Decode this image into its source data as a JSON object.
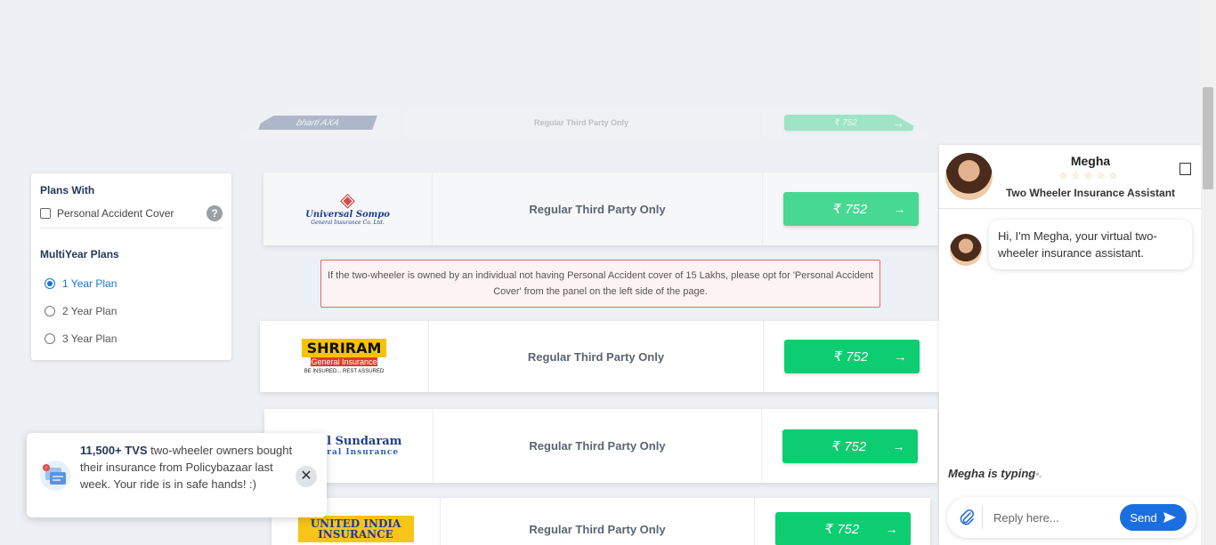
{
  "filters": {
    "plans_with_title": "Plans With",
    "personal_accident_label": "Personal Accident Cover",
    "help_icon": "?",
    "multiyear_title": "MultiYear Plans",
    "options": [
      {
        "label": "1 Year Plan",
        "selected": true
      },
      {
        "label": "2 Year Plan",
        "selected": false
      },
      {
        "label": "3 Year Plan",
        "selected": false
      }
    ]
  },
  "plans": [
    {
      "insurer_logo_text": "bharti AXA",
      "description": "Regular Third Party Only",
      "price": "₹ 752",
      "arrow": "→"
    },
    {
      "insurer_logo_text": "Universal Sompo",
      "insurer_logo_sub": "General Insurance Co. Ltd.",
      "description": "Regular Third Party Only",
      "price": "₹ 752",
      "arrow": "→"
    },
    {
      "insurer_logo_text": "SHRIRAM",
      "insurer_logo_sub": "General Insurance",
      "insurer_logo_tag": "BE INSURED... REST ASSURED",
      "description": "Regular Third Party Only",
      "price": "₹ 752",
      "arrow": "→"
    },
    {
      "insurer_logo_text": "Royal Sundaram",
      "insurer_logo_sub": "General Insurance",
      "description": "Regular Third Party Only",
      "price": "₹ 752",
      "arrow": "→"
    },
    {
      "insurer_logo_text": "UNITED INDIA INSURANCE",
      "description": "Regular Third Party Only",
      "price": "₹ 752",
      "arrow": "→"
    }
  ],
  "notice": {
    "text": "If the two-wheeler is owned by an individual not having Personal Accident cover of 15 Lakhs, please opt for 'Personal Accident Cover' from the panel on the left side of the page."
  },
  "toast": {
    "highlight": "11,500+ TVS",
    "text": " two-wheeler owners bought their insurance from Policybazaar last week. Your ride is in safe hands! :)",
    "close_icon": "✕"
  },
  "chat": {
    "agent_name": "Megha",
    "stars": "☆☆☆☆☆",
    "role": "Two Wheeler Insurance Assistant",
    "message": "Hi, I'm Megha, your virtual two-wheeler insurance assistant.",
    "typing": "Megha is typing",
    "typing_dots": "•.",
    "input_placeholder": "Reply here...",
    "send_label": "Send"
  },
  "colors": {
    "price_green": "#0ccd70",
    "notice_border": "#e66a6a",
    "send_blue": "#1a6fe0",
    "selected_blue": "#1677d2"
  }
}
